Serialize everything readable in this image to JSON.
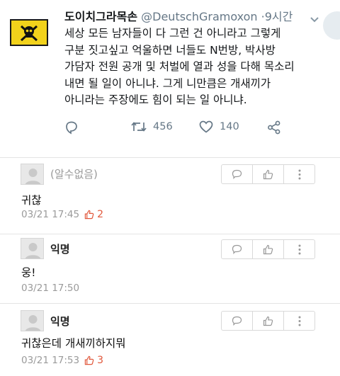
{
  "tweet": {
    "display_name": "도이치그라목손",
    "handle": "@DeutschGramoxon",
    "separator": "·",
    "time": "9시간",
    "text_lines": [
      "세상 모든 남자들이 다 그런 건 아니라고 그렇게",
      "구분 짓고싶고 억울하면 너들도 N번방, 박사방",
      "가담자 전원 공개 및 처벌에 열과 성을 다해 목소리",
      "내면 될 일이 아니냐. 그게 니만큼은 개새끼가",
      "아니라는 주장에도 힘이 되는 일 아니냐."
    ],
    "retweet_count": "456",
    "like_count": "140"
  },
  "comments": [
    {
      "author": "(알수없음)",
      "text": "귀찮",
      "date": "03/21 17:45",
      "likes": "2"
    },
    {
      "author": "익명",
      "text": "웅!",
      "date": "03/21 17:50",
      "likes": ""
    },
    {
      "author": "익명",
      "text": "귀찮은데 개새끼하지뭐",
      "date": "03/21 17:53",
      "likes": "3"
    }
  ],
  "icons": {
    "flag": "skull-flag-avatar",
    "reply": "reply-icon",
    "retweet": "retweet-icon",
    "like": "heart-icon",
    "share": "share-icon",
    "comment_reply": "comment-reply-icon",
    "thumbs_up": "thumbs-up-icon",
    "more": "more-vertical-icon",
    "default_avatar": "default-avatar-icon"
  },
  "colors": {
    "handle_gray": "#657786",
    "flag_yellow": "#f2d21b",
    "like_red": "#e1583c",
    "meta_gray": "#9a9a9a"
  }
}
